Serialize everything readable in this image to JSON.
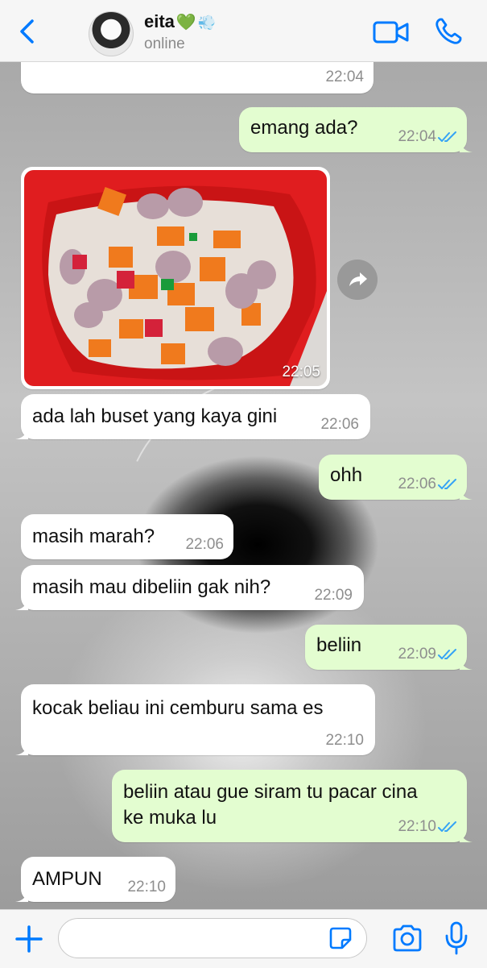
{
  "header": {
    "contact_name": "eita",
    "name_emoji_heart": "💚",
    "name_emoji_dash": "💨",
    "status": "online"
  },
  "messages": [
    {
      "direction": "in",
      "text": "",
      "time": "22:04"
    },
    {
      "direction": "out",
      "text": "emang ada?",
      "time": "22:04",
      "read": true
    },
    {
      "direction": "in",
      "type": "photo",
      "time": "22:05"
    },
    {
      "direction": "in",
      "text": "ada lah buset yang kaya gini",
      "time": "22:06"
    },
    {
      "direction": "out",
      "text": "ohh",
      "time": "22:06",
      "read": true
    },
    {
      "direction": "in",
      "text": "masih marah?",
      "time": "22:06"
    },
    {
      "direction": "in",
      "text": "masih mau dibeliin gak nih?",
      "time": "22:09"
    },
    {
      "direction": "out",
      "text": "beliin",
      "time": "22:09",
      "read": true
    },
    {
      "direction": "in",
      "text": "kocak beliau ini cemburu sama es",
      "time": "22:10"
    },
    {
      "direction": "out",
      "lines": [
        "beliin atau gue siram tu pacar cina",
        "ke muka lu"
      ],
      "time": "22:10",
      "read": true
    },
    {
      "direction": "in",
      "text": "AMPUN",
      "time": "22:10"
    }
  ],
  "composer": {
    "placeholder": ""
  },
  "colors": {
    "accent": "#007aff",
    "outgoing_bubble": "#e3fdd0",
    "incoming_bubble": "#ffffff",
    "read_ticks": "#35a3f5"
  },
  "icons": {
    "back": "chevron-left-icon",
    "video": "video-camera-icon",
    "call": "phone-icon",
    "forward": "forward-arrow-icon",
    "plus": "plus-icon",
    "sticker": "sticker-icon",
    "camera": "camera-icon",
    "mic": "microphone-icon"
  }
}
